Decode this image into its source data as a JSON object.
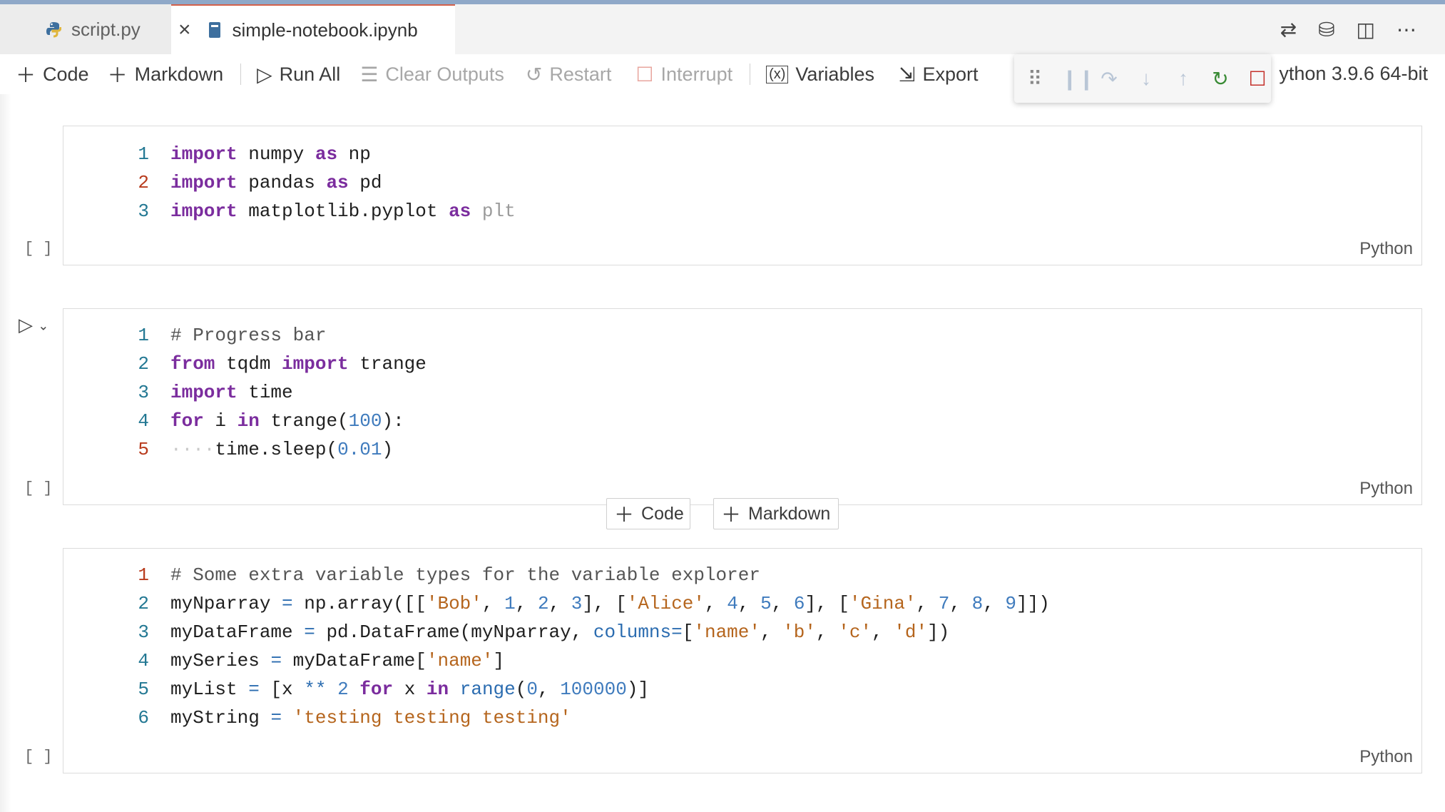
{
  "tabs": [
    {
      "label": "script.py",
      "active": false
    },
    {
      "label": "simple-notebook.ipynb",
      "active": true
    }
  ],
  "toolbar": {
    "code": "Code",
    "markdown": "Markdown",
    "run_all": "Run All",
    "clear_outputs": "Clear Outputs",
    "restart": "Restart",
    "interrupt": "Interrupt",
    "variables": "Variables",
    "export": "Export",
    "kernel": "ython 3.9.6 64-bit"
  },
  "cells": [
    {
      "exec": "[ ]",
      "language": "Python",
      "line_numbers": [
        "1",
        "2",
        "3"
      ]
    },
    {
      "exec": "[ ]",
      "language": "Python",
      "line_numbers": [
        "1",
        "2",
        "3",
        "4",
        "5"
      ]
    },
    {
      "exec": "[ ]",
      "language": "Python",
      "line_numbers": [
        "1",
        "2",
        "3",
        "4",
        "5",
        "6"
      ]
    }
  ],
  "add_cell": {
    "code": "Code",
    "markdown": "Markdown"
  },
  "colors": {
    "accent_tab": "#d3604a",
    "keyword": "#7b2d9e",
    "number": "#3f7bbd",
    "string": "#b5651d",
    "breakpoint": "#d53a32"
  }
}
